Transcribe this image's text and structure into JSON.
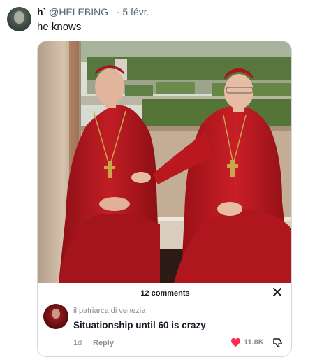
{
  "tweet": {
    "display_name": "h`",
    "handle": "@HELEBING_",
    "separator": "·",
    "date": "5 févr.",
    "text": "he knows"
  },
  "comments_sheet": {
    "title": "12 comments",
    "comment": {
      "username": "il patriarca di venezia",
      "text": "Situationship until 60 is crazy",
      "time": "1d",
      "reply_label": "Reply",
      "likes": "11.8K"
    }
  },
  "colors": {
    "heart": "#fe2c55",
    "robe": "#b3161d",
    "hedge": "#5f7f44",
    "wall": "#c9b49c"
  },
  "icons": [
    "close-icon",
    "heart-icon",
    "dislike-icon"
  ]
}
